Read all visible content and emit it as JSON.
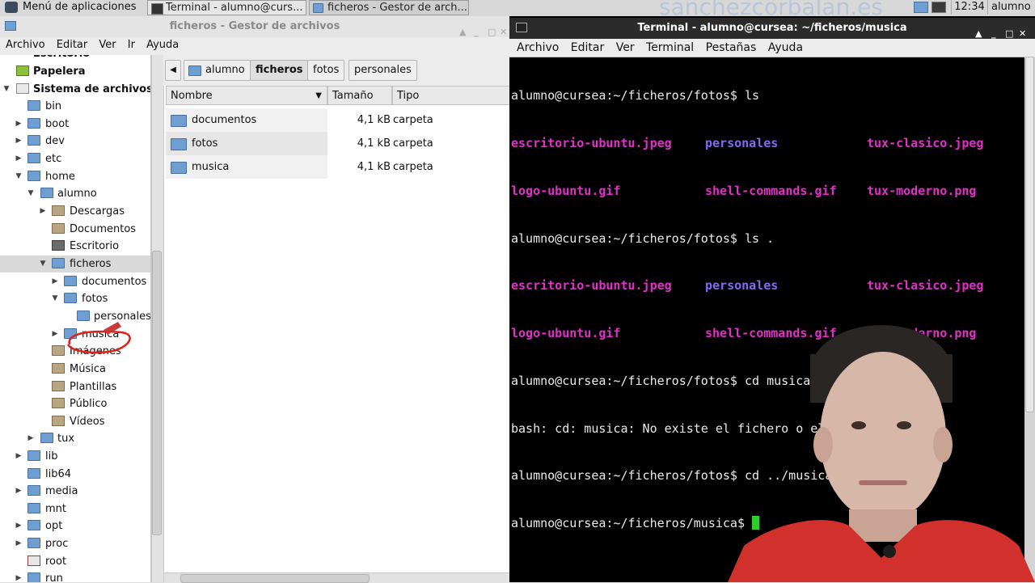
{
  "panel": {
    "app_menu": "Menú de aplicaciones",
    "tasks": [
      "Terminal - alumno@curs...",
      "ficheros - Gestor de arch..."
    ],
    "watermark": "sanchezcorbalan.es",
    "clock": "12:34",
    "user": "alumno"
  },
  "file_manager": {
    "title": "ficheros - Gestor de archivos",
    "menu": [
      "Archivo",
      "Editar",
      "Ver",
      "Ir",
      "Ayuda"
    ],
    "sidebar": {
      "escritorio_partial": "Escritorio",
      "papelera": "Papelera",
      "sistema": "Sistema de archivos",
      "tree": [
        "bin",
        "boot",
        "dev",
        "etc",
        "home",
        "alumno",
        "Descargas",
        "Documentos",
        "Escritorio",
        "ficheros",
        "documentos",
        "fotos",
        "personales",
        "musica",
        "Imágenes",
        "Música",
        "Plantillas",
        "Público",
        "Vídeos",
        "tux",
        "lib",
        "lib64",
        "media",
        "mnt",
        "opt",
        "proc",
        "root",
        "run"
      ]
    },
    "path": [
      "alumno",
      "ficheros",
      "fotos",
      "personales"
    ],
    "columns": [
      "Nombre",
      "Tamaño",
      "Tipo"
    ],
    "rows": [
      {
        "name": "documentos",
        "size": "4,1 kB",
        "type": "carpeta"
      },
      {
        "name": "fotos",
        "size": "4,1 kB",
        "type": "carpeta"
      },
      {
        "name": "musica",
        "size": "4,1 kB",
        "type": "carpeta"
      }
    ]
  },
  "terminal": {
    "title": "Terminal - alumno@cursea: ~/ficheros/musica",
    "menu": [
      "Archivo",
      "Editar",
      "Ver",
      "Terminal",
      "Pestañas",
      "Ayuda"
    ],
    "prompt_fotos": "alumno@cursea:~/ficheros/fotos$ ",
    "prompt_musica": "alumno@cursea:~/ficheros/musica$ ",
    "cmd1": "ls",
    "cmd2": "ls .",
    "cmd3": "cd musica",
    "cmd4": "cd ../musica/",
    "err": "bash: cd: musica: No existe el fichero o el directorio",
    "files": {
      "f1": "escritorio-ubuntu.jpeg",
      "f2": "personales",
      "f3": "tux-clasico.jpeg",
      "f4": "logo-ubuntu.gif",
      "f5": "shell-commands.gif",
      "f6": "tux-moderno.png"
    }
  },
  "colors": {
    "terminal_bg": "#000000",
    "file_magenta": "#e030c8",
    "dir_blue": "#7f6cf0",
    "cursor_green": "#2ecc2e",
    "annotation_red": "#e0201c"
  }
}
